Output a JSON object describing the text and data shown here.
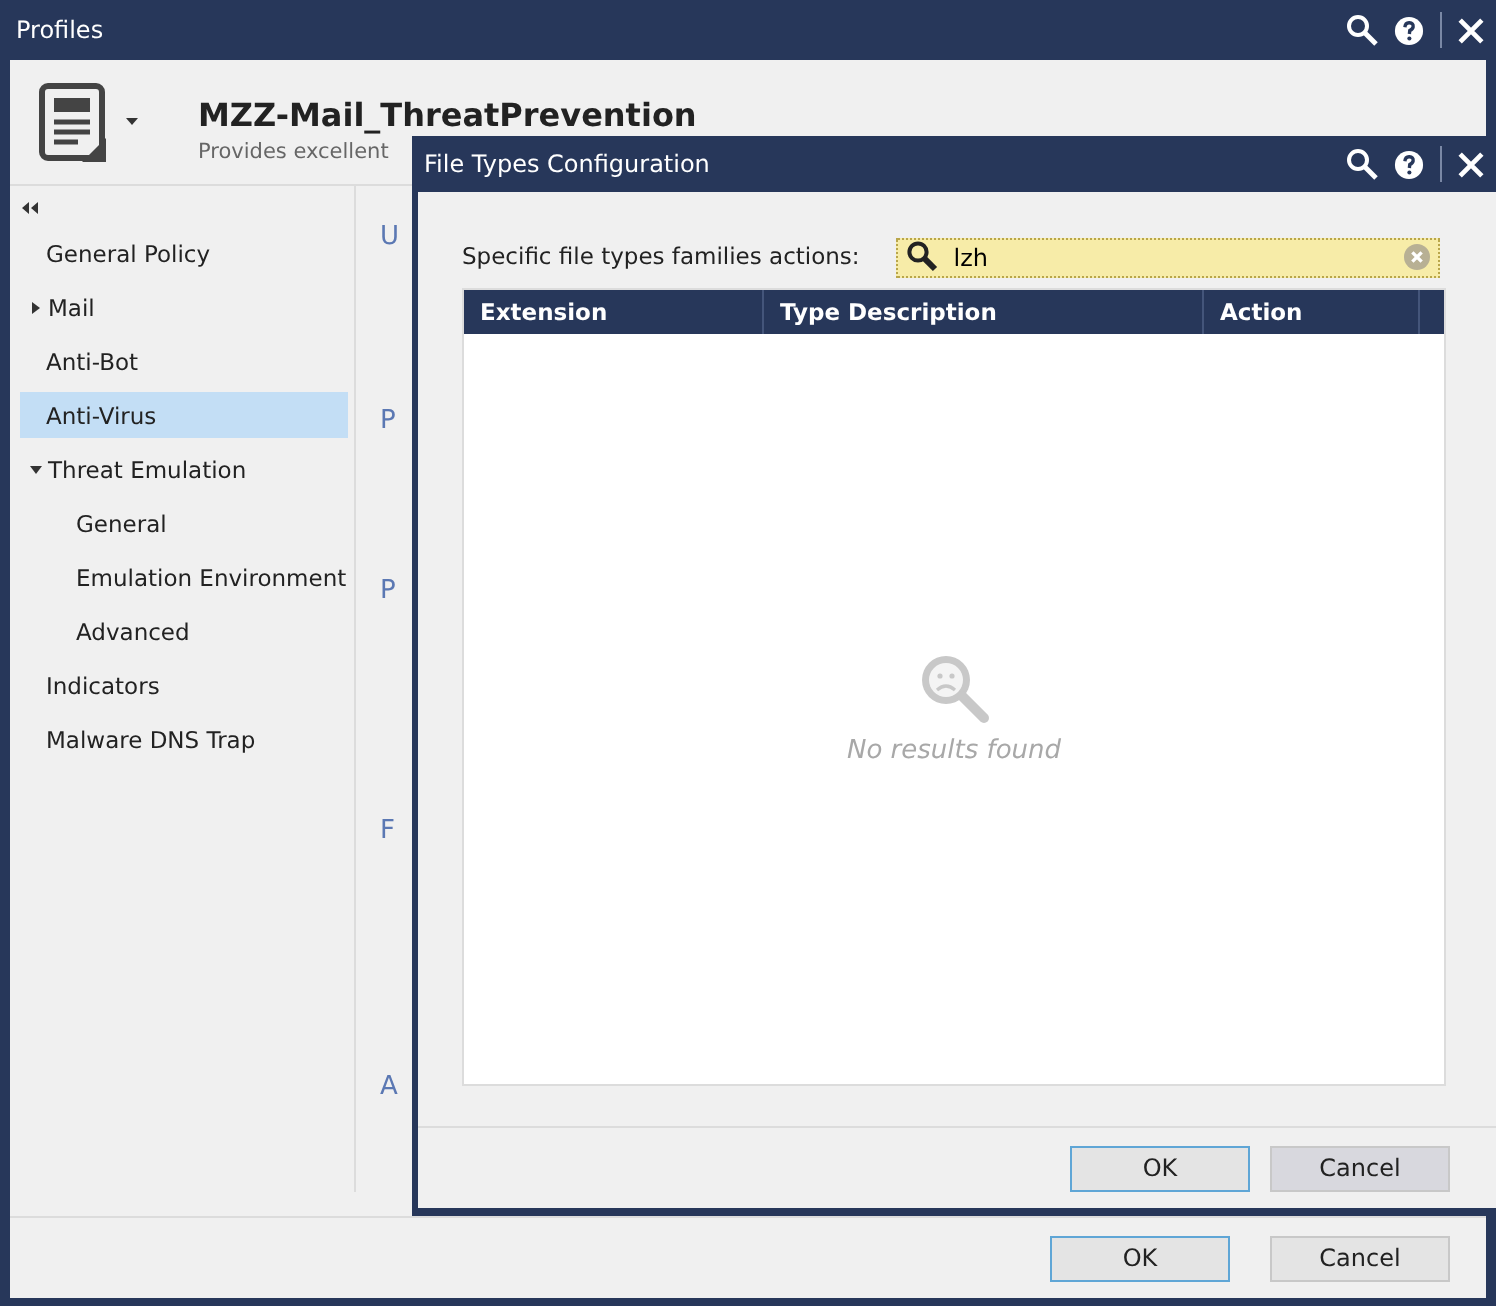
{
  "window": {
    "title": "Profiles"
  },
  "profile": {
    "name": "MZZ-Mail_ThreatPrevention",
    "description": "Provides excellent"
  },
  "sidebar": {
    "items": [
      {
        "label": "General Policy",
        "selected": false
      },
      {
        "label": "Mail",
        "selected": false,
        "expanded": false
      },
      {
        "label": "Anti-Bot",
        "selected": false
      },
      {
        "label": "Anti-Virus",
        "selected": true
      },
      {
        "label": "Threat Emulation",
        "selected": false,
        "expanded": true,
        "children": [
          {
            "label": "General",
            "selected": false
          },
          {
            "label": "Emulation Environment",
            "selected": false
          },
          {
            "label": "Advanced",
            "selected": false
          }
        ]
      },
      {
        "label": "Indicators",
        "selected": false
      },
      {
        "label": "Malware DNS Trap",
        "selected": false
      }
    ]
  },
  "content": {
    "section_headings": [
      "U",
      "P",
      "P",
      "F",
      "A"
    ]
  },
  "buttons": [
    "OK",
    "Cancel"
  ],
  "dialog": {
    "title": "File Types Configuration",
    "search_label": "Specific file types families actions:",
    "search": {
      "value": "lzh"
    },
    "table": {
      "columns": [
        "Extension",
        "Type Description",
        "Action"
      ],
      "empty_message": "No results found"
    },
    "buttons": [
      "OK",
      "Cancel"
    ]
  }
}
